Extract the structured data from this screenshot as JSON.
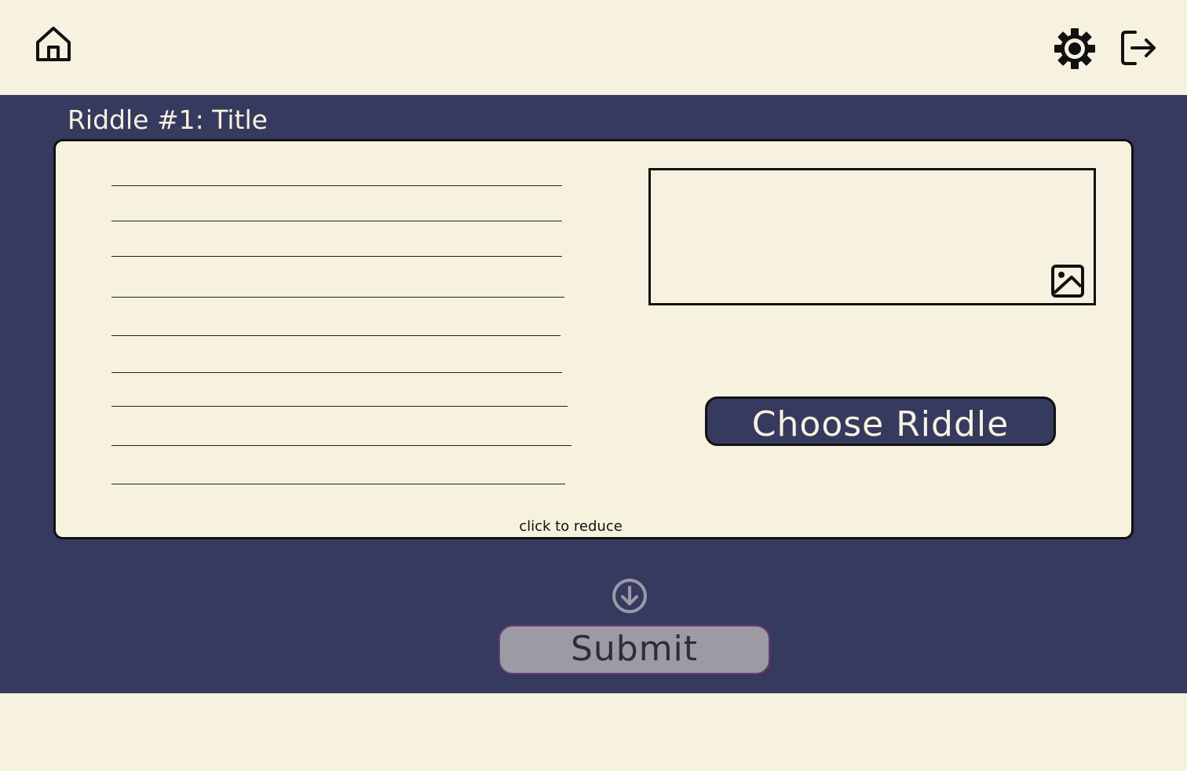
{
  "header": {
    "home_icon": "home-icon",
    "settings_icon": "gear-icon",
    "logout_icon": "logout-icon"
  },
  "riddle": {
    "title": "Riddle #1: Title",
    "image_icon": "image-icon",
    "choose_label": "Choose Riddle",
    "reduce_label": "click to reduce"
  },
  "footer": {
    "down_icon": "arrow-down-circle-icon",
    "submit_label": "Submit"
  },
  "colors": {
    "background": "#f7f2df",
    "band": "#363a5f",
    "submit_bg": "#9b9aa5",
    "submit_border": "#6b3b6e"
  }
}
